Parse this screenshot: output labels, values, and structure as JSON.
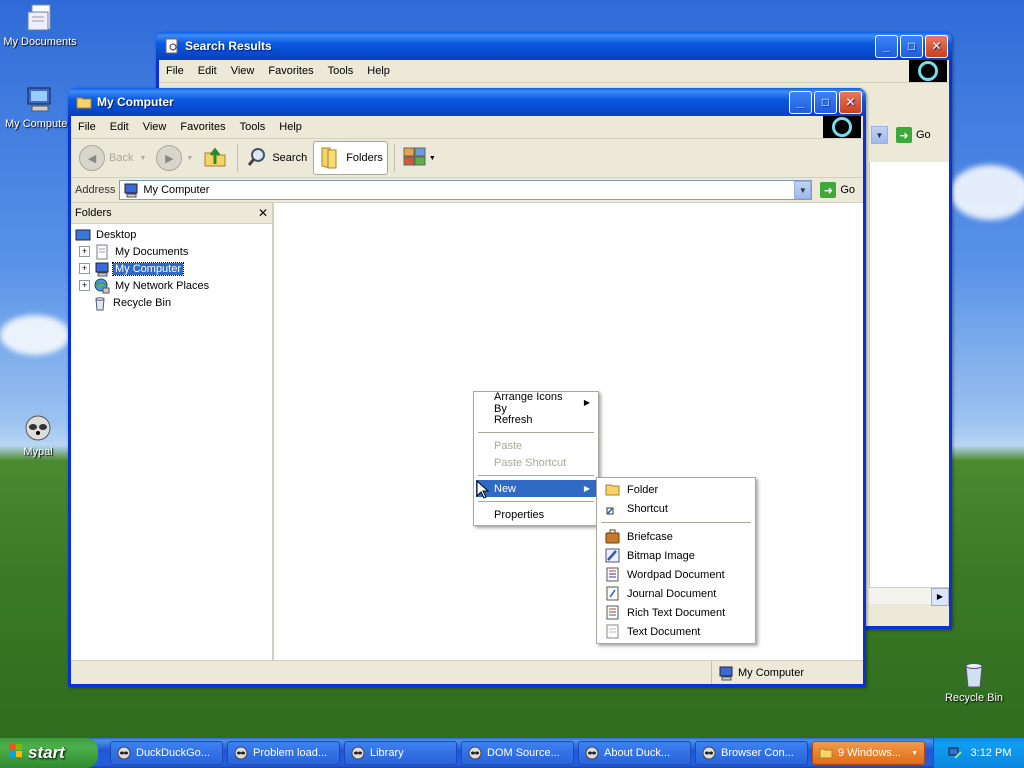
{
  "desktop": {
    "icons": [
      {
        "label": "My Documents"
      },
      {
        "label": "My Computer"
      },
      {
        "label": "Mypal"
      },
      {
        "label": "Recycle Bin"
      }
    ]
  },
  "search_window": {
    "title": "Search Results",
    "menu": [
      "File",
      "Edit",
      "View",
      "Favorites",
      "Tools",
      "Help"
    ],
    "go_label": "Go"
  },
  "main_window": {
    "title": "My Computer",
    "menu": [
      "File",
      "Edit",
      "View",
      "Favorites",
      "Tools",
      "Help"
    ],
    "toolbar": {
      "back": "Back",
      "search": "Search",
      "folders": "Folders"
    },
    "address": {
      "label": "Address",
      "value": "My Computer",
      "go": "Go"
    },
    "folders_pane": {
      "header": "Folders",
      "tree": [
        {
          "label": "Desktop"
        },
        {
          "label": "My Documents"
        },
        {
          "label": "My Computer"
        },
        {
          "label": "My Network Places"
        },
        {
          "label": "Recycle Bin"
        }
      ]
    },
    "status": "My Computer"
  },
  "context_menu": {
    "items": [
      "Arrange Icons By",
      "Refresh",
      "Paste",
      "Paste Shortcut",
      "New",
      "Properties"
    ]
  },
  "new_submenu": {
    "items": [
      "Folder",
      "Shortcut",
      "Briefcase",
      "Bitmap Image",
      "Wordpad Document",
      "Journal Document",
      "Rich Text Document",
      "Text Document"
    ]
  },
  "taskbar": {
    "start": "start",
    "tasks": [
      "DuckDuckGo...",
      "Problem load...",
      "Library",
      "DOM Source...",
      "About Duck...",
      "Browser Con...",
      "9 Windows..."
    ],
    "clock": "3:12 PM"
  },
  "colors": {
    "selection": "#316ac5",
    "titlebar": "#0a5fe8",
    "taskbar": "#245edb",
    "start": "#3c9b3c"
  }
}
